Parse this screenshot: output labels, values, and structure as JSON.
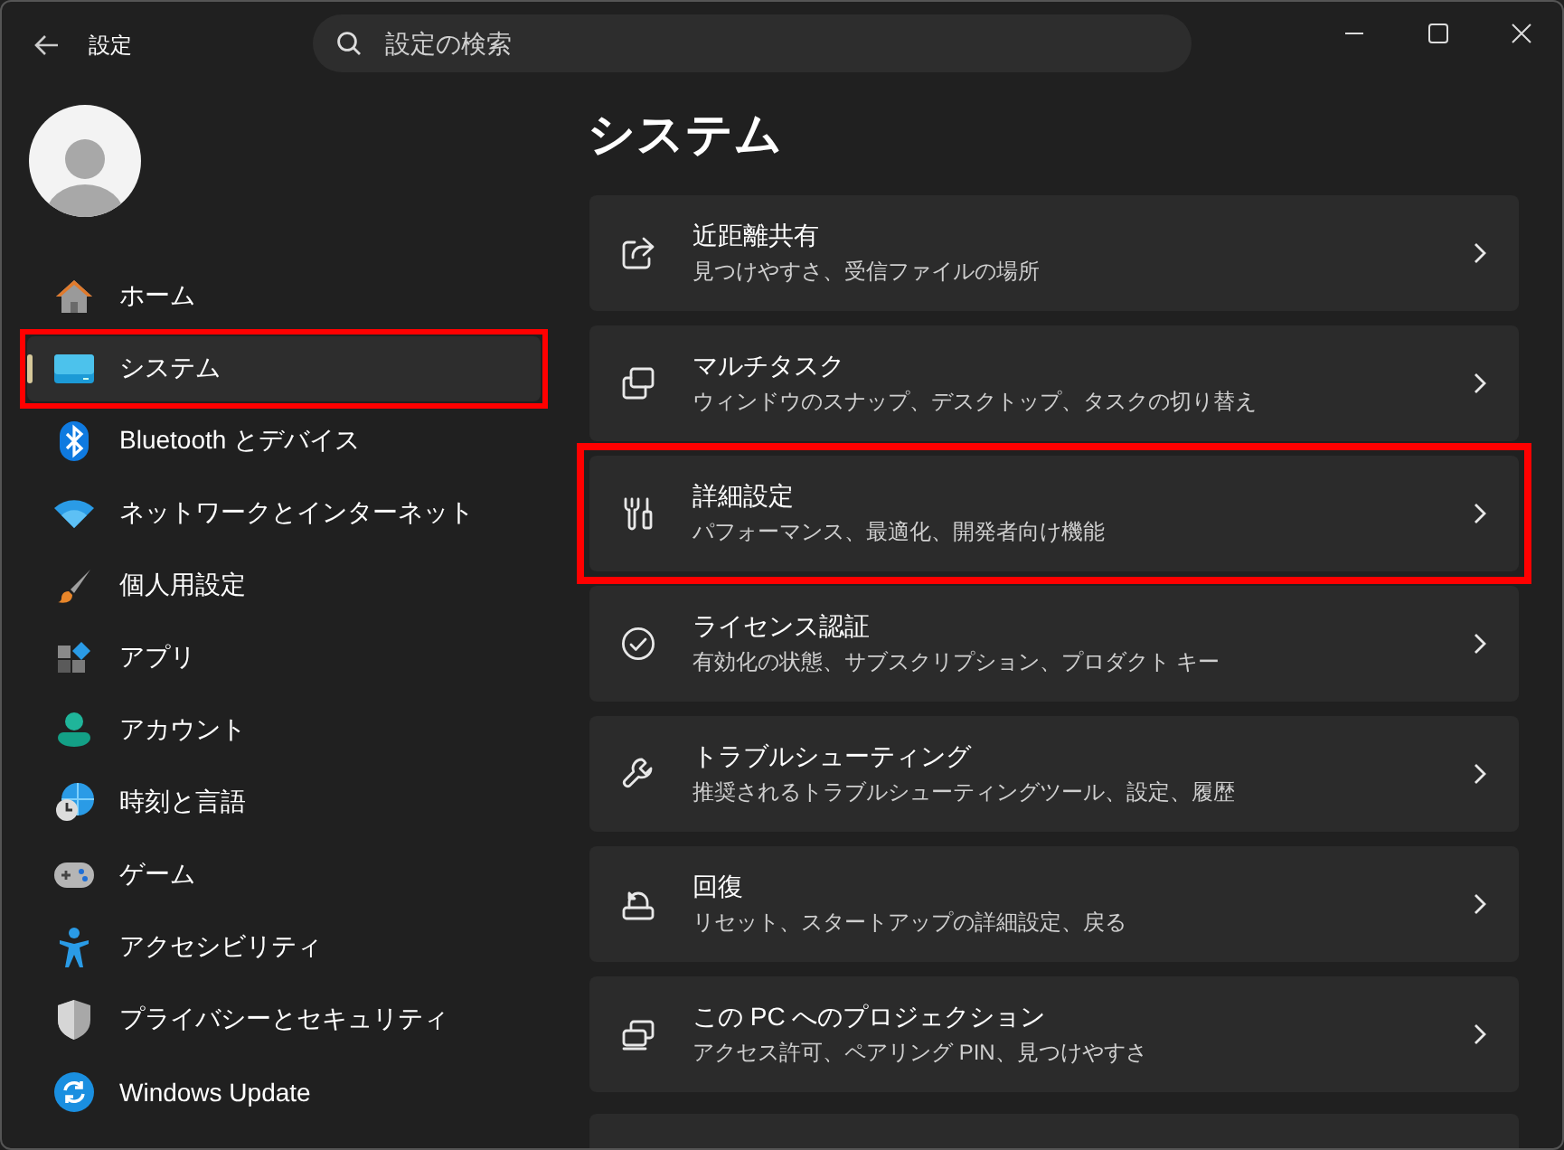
{
  "window": {
    "title": "設定",
    "search": {
      "placeholder": "設定の検索"
    }
  },
  "sidebar": {
    "items": [
      {
        "label": "ホーム",
        "selected": false,
        "highlighted": false
      },
      {
        "label": "システム",
        "selected": true,
        "highlighted": true
      },
      {
        "label": "Bluetooth とデバイス",
        "selected": false,
        "highlighted": false
      },
      {
        "label": "ネットワークとインターネット",
        "selected": false,
        "highlighted": false
      },
      {
        "label": "個人用設定",
        "selected": false,
        "highlighted": false
      },
      {
        "label": "アプリ",
        "selected": false,
        "highlighted": false
      },
      {
        "label": "アカウント",
        "selected": false,
        "highlighted": false
      },
      {
        "label": "時刻と言語",
        "selected": false,
        "highlighted": false
      },
      {
        "label": "ゲーム",
        "selected": false,
        "highlighted": false
      },
      {
        "label": "アクセシビリティ",
        "selected": false,
        "highlighted": false
      },
      {
        "label": "プライバシーとセキュリティ",
        "selected": false,
        "highlighted": false
      },
      {
        "label": "Windows Update",
        "selected": false,
        "highlighted": false
      }
    ]
  },
  "page": {
    "title": "システム",
    "cards": [
      {
        "title": "近距離共有",
        "subtitle": "見つけやすさ、受信ファイルの場所",
        "highlighted": false
      },
      {
        "title": "マルチタスク",
        "subtitle": "ウィンドウのスナップ、デスクトップ、タスクの切り替え",
        "highlighted": false
      },
      {
        "title": "詳細設定",
        "subtitle": "パフォーマンス、最適化、開発者向け機能",
        "highlighted": true
      },
      {
        "title": "ライセンス認証",
        "subtitle": "有効化の状態、サブスクリプション、プロダクト キー",
        "highlighted": false
      },
      {
        "title": "トラブルシューティング",
        "subtitle": "推奨されるトラブルシューティングツール、設定、履歴",
        "highlighted": false
      },
      {
        "title": "回復",
        "subtitle": "リセット、スタートアップの詳細設定、戻る",
        "highlighted": false
      },
      {
        "title": "この PC へのプロジェクション",
        "subtitle": "アクセス許可、ペアリング PIN、見つけやすさ",
        "highlighted": false
      }
    ]
  }
}
